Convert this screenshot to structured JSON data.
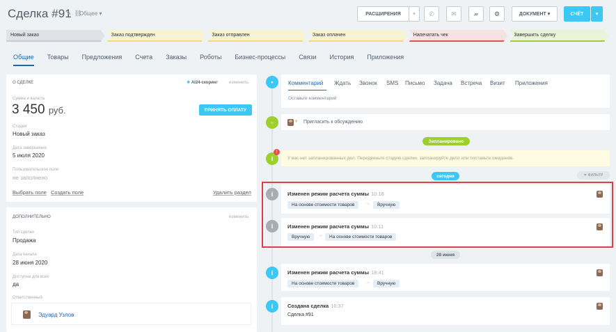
{
  "header": {
    "title": "Сделка",
    "number": "#91",
    "category": "Общее",
    "ext_label": "РАСШИРЕНИЯ",
    "doc_label": "ДОКУМЕНТ",
    "invoice_label": "СЧЁТ"
  },
  "stages": [
    {
      "label": "Новый заказ",
      "color": "#dfe3e6",
      "bar": "#c9ccd0"
    },
    {
      "label": "Заказ подтвержден",
      "color": "#f7f2d2",
      "bar": "#f0dc70"
    },
    {
      "label": "Заказ отправлен",
      "color": "#f7f2d2",
      "bar": "#f0dc70"
    },
    {
      "label": "Заказ оплачен",
      "color": "#f7f2d2",
      "bar": "#f0dc70"
    },
    {
      "label": "Напечатать чек",
      "color": "#f6e2e2",
      "bar": "#e5504e"
    },
    {
      "label": "Завершить сделку",
      "color": "#e8f3da",
      "bar": "#9dcf2e"
    }
  ],
  "tabs": [
    "Общие",
    "Товары",
    "Предложения",
    "Счета",
    "Заказы",
    "Роботы",
    "Бизнес-процессы",
    "Связи",
    "История",
    "Приложения"
  ],
  "about": {
    "caption": "О СДЕЛКЕ",
    "scoring": "AI24-скоринг",
    "edit": "изменить",
    "amount_label": "Сумма и валюта",
    "amount": "3 450",
    "currency": "руб.",
    "pay_button": "ПРИНЯТЬ ОПЛАТУ",
    "stage_label": "Стадия",
    "stage": "Новый заказ",
    "close_label": "Дата завершения",
    "close": "5 июля 2020",
    "custom_label": "Пользовательское поле",
    "custom": "не заполнено",
    "select_field": "Выбрать поле",
    "create_field": "Создать поле",
    "delete_section": "Удалить раздел"
  },
  "extra": {
    "caption": "ДОПОЛНИТЕЛЬНО",
    "edit": "изменить",
    "type_label": "Тип сделки",
    "type": "Продажа",
    "start_label": "Дата начала",
    "start": "28 июня 2020",
    "avail_label": "Доступна для всех",
    "avail": "да",
    "resp_label": "Ответственный",
    "resp": "Эдуард Узлов"
  },
  "timeline": {
    "tabs": [
      "Комментарий",
      "Ждать",
      "Звонок",
      "SMS",
      "Письмо",
      "Задача",
      "Встреча",
      "Визит",
      "Приложения"
    ],
    "comment_placeholder": "Оставьте комментарий",
    "invite": "Пригласить к обсуждению",
    "planned": "Запланировано",
    "no_plans": "У вас нет запланированных дел. Передвиньте стадию сделки, запланируйте дело или поставьте ожидание.",
    "today": "сегодня",
    "filter": "ФИЛЬТР",
    "date2": "28 июня",
    "events": [
      {
        "title": "Изменен режим расчета суммы",
        "time": "10:18",
        "from": "На основе стоимости товаров",
        "to": "Вручную"
      },
      {
        "title": "Изменен режим расчета суммы",
        "time": "10:11",
        "from": "Вручную",
        "to": "На основе стоимости товаров"
      },
      {
        "title": "Изменен режим расчета суммы",
        "time": "18:41",
        "from": "На основе стоимости товаров",
        "to": "Вручную"
      }
    ],
    "created": {
      "title": "Создана сделка",
      "time": "16:37",
      "sub": "Сделка #91"
    }
  }
}
